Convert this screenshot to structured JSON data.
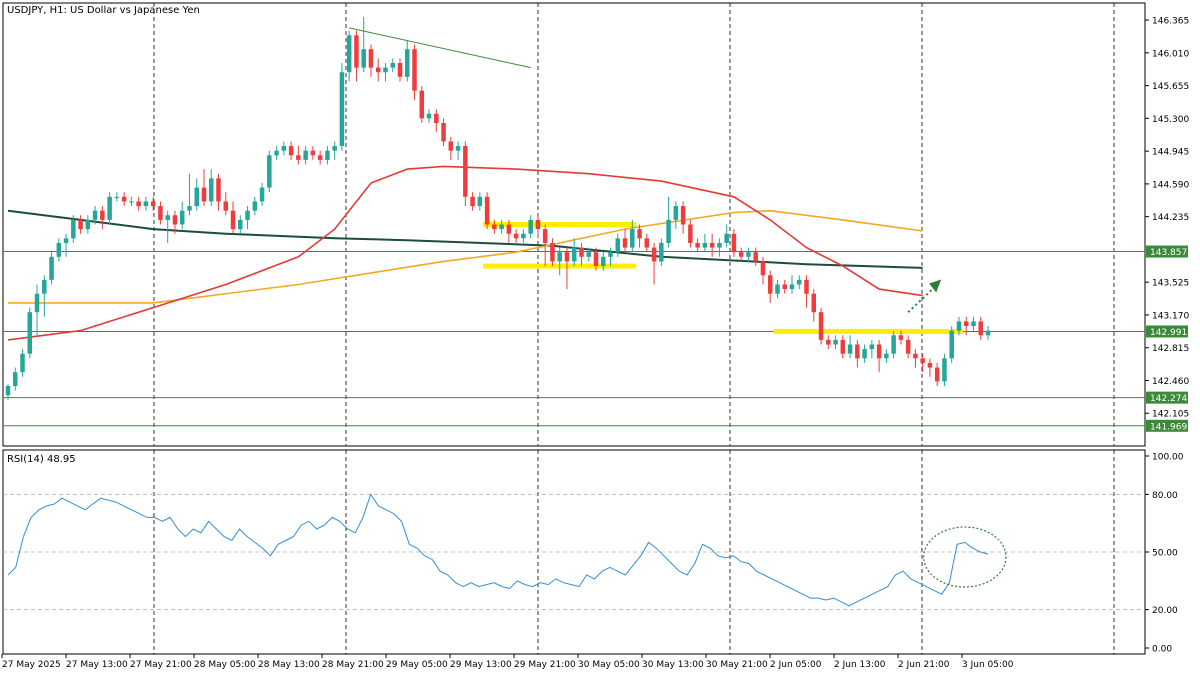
{
  "header": {
    "symbol_label": "USDJPY, H1:  US Dollar vs Japanese Yen",
    "rsi_label": "RSI(14) 48.95"
  },
  "colors": {
    "bull": "#26a69a",
    "bear": "#ef3d3d",
    "ma_fast": "#e53935",
    "ma_mid": "#f5a623",
    "ma_slow": "#1b4d3e",
    "rsi_line": "#2f8fd8",
    "zone": "#ffee00",
    "hline": "#3a8a3a",
    "trend": "#3a8a3a",
    "arrow": "#2e7d32"
  },
  "chart_data": [
    {
      "type": "candlestick",
      "title": "USDJPY, H1:  US Dollar vs Japanese Yen",
      "ylim": [
        141.75,
        146.55
      ],
      "yticks": [
        "146.365",
        "146.010",
        "145.655",
        "145.300",
        "144.945",
        "144.590",
        "144.235",
        "143.525",
        "143.170",
        "142.815",
        "142.460",
        "142.105"
      ],
      "price_lines": [
        {
          "label": "143.857",
          "value": 143.857
        },
        {
          "label": "142.991",
          "value": 142.991
        },
        {
          "label": "142.274",
          "value": 142.274
        },
        {
          "label": "141.969",
          "value": 141.969
        }
      ],
      "xticks": [
        "27 May 2025",
        "27 May 13:00",
        "27 May 21:00",
        "28 May 05:00",
        "28 May 13:00",
        "28 May 21:00",
        "29 May 05:00",
        "29 May 13:00",
        "29 May 21:00",
        "30 May 05:00",
        "30 May 13:00",
        "30 May 21:00",
        "2 Jun 05:00",
        "2 Jun 13:00",
        "2 Jun 21:00",
        "3 Jun 05:00"
      ],
      "candles": [
        [
          142.3,
          142.4,
          142.25,
          142.42
        ],
        [
          142.4,
          142.55,
          142.35,
          142.6
        ],
        [
          142.55,
          142.75,
          142.5,
          142.8
        ],
        [
          142.75,
          143.2,
          142.7,
          143.25
        ],
        [
          143.2,
          143.4,
          142.95,
          143.5
        ],
        [
          143.4,
          143.55,
          143.15,
          143.6
        ],
        [
          143.55,
          143.8,
          143.5,
          143.85
        ],
        [
          143.8,
          143.95,
          143.75,
          144.0
        ],
        [
          143.95,
          144.0,
          143.8,
          144.05
        ],
        [
          144.0,
          144.2,
          143.95,
          144.25
        ],
        [
          144.2,
          144.1,
          144.05,
          144.25
        ],
        [
          144.1,
          144.2,
          144.05,
          144.25
        ],
        [
          144.2,
          144.3,
          144.15,
          144.35
        ],
        [
          144.3,
          144.2,
          144.1,
          144.35
        ],
        [
          144.2,
          144.45,
          144.15,
          144.5
        ],
        [
          144.45,
          144.45,
          144.4,
          144.5
        ],
        [
          144.45,
          144.4,
          144.35,
          144.5
        ],
        [
          144.4,
          144.4,
          144.35,
          144.45
        ],
        [
          144.4,
          144.35,
          144.3,
          144.45
        ],
        [
          144.35,
          144.4,
          144.3,
          144.45
        ],
        [
          144.4,
          144.35,
          144.3,
          144.45
        ],
        [
          144.35,
          144.2,
          144.15,
          144.4
        ],
        [
          144.2,
          144.25,
          143.95,
          144.3
        ],
        [
          144.25,
          144.15,
          144.05,
          144.3
        ],
        [
          144.15,
          144.3,
          144.1,
          144.4
        ],
        [
          144.3,
          144.35,
          144.25,
          144.7
        ],
        [
          144.35,
          144.55,
          144.3,
          144.65
        ],
        [
          144.55,
          144.4,
          144.35,
          144.75
        ],
        [
          144.4,
          144.65,
          144.35,
          144.75
        ],
        [
          144.65,
          144.4,
          144.3,
          144.7
        ],
        [
          144.4,
          144.3,
          144.25,
          144.5
        ],
        [
          144.3,
          144.1,
          144.05,
          144.4
        ],
        [
          144.1,
          144.2,
          144.05,
          144.25
        ],
        [
          144.2,
          144.3,
          144.1,
          144.35
        ],
        [
          144.3,
          144.4,
          144.25,
          144.45
        ],
        [
          144.4,
          144.55,
          144.35,
          144.6
        ],
        [
          144.55,
          144.9,
          144.5,
          144.95
        ],
        [
          144.9,
          144.95,
          144.85,
          145.0
        ],
        [
          144.95,
          145.0,
          144.9,
          145.05
        ],
        [
          145.0,
          144.9,
          144.85,
          145.05
        ],
        [
          144.9,
          144.85,
          144.8,
          145.0
        ],
        [
          144.85,
          144.95,
          144.8,
          145.0
        ],
        [
          144.95,
          144.9,
          144.85,
          145.0
        ],
        [
          144.9,
          144.85,
          144.8,
          144.95
        ],
        [
          144.85,
          144.95,
          144.8,
          145.0
        ],
        [
          144.95,
          145.0,
          144.85,
          145.05
        ],
        [
          145.0,
          145.8,
          144.95,
          145.9
        ],
        [
          145.8,
          146.2,
          145.7,
          146.25
        ],
        [
          146.2,
          145.85,
          145.7,
          146.25
        ],
        [
          145.85,
          146.05,
          145.8,
          146.4
        ],
        [
          146.05,
          145.85,
          145.75,
          146.1
        ],
        [
          145.85,
          145.8,
          145.7,
          145.95
        ],
        [
          145.8,
          145.85,
          145.7,
          145.9
        ],
        [
          145.85,
          145.9,
          145.8,
          145.95
        ],
        [
          145.9,
          145.75,
          145.7,
          145.95
        ],
        [
          145.75,
          146.05,
          145.7,
          146.15
        ],
        [
          146.05,
          145.6,
          145.5,
          146.1
        ],
        [
          145.6,
          145.3,
          145.25,
          145.65
        ],
        [
          145.3,
          145.35,
          145.25,
          145.4
        ],
        [
          145.35,
          145.25,
          145.15,
          145.4
        ],
        [
          145.25,
          145.05,
          145.0,
          145.3
        ],
        [
          145.05,
          144.95,
          144.85,
          145.1
        ],
        [
          144.95,
          145.0,
          144.85,
          145.05
        ],
        [
          145.0,
          144.45,
          144.35,
          145.05
        ],
        [
          144.45,
          144.35,
          144.3,
          144.5
        ],
        [
          144.35,
          144.45,
          144.3,
          144.5
        ],
        [
          144.45,
          144.15,
          144.1,
          144.5
        ],
        [
          144.15,
          144.1,
          144.05,
          144.2
        ],
        [
          144.1,
          144.15,
          144.05,
          144.2
        ],
        [
          144.15,
          144.05,
          143.95,
          144.2
        ],
        [
          144.05,
          144.0,
          143.95,
          144.1
        ],
        [
          144.0,
          144.05,
          143.95,
          144.1
        ],
        [
          144.05,
          144.2,
          144.0,
          144.25
        ],
        [
          144.2,
          144.1,
          144.0,
          144.25
        ],
        [
          144.1,
          143.95,
          143.7,
          144.15
        ],
        [
          143.95,
          143.75,
          143.7,
          144.0
        ],
        [
          143.75,
          143.85,
          143.6,
          143.9
        ],
        [
          143.85,
          143.75,
          143.45,
          143.9
        ],
        [
          143.75,
          143.9,
          143.7,
          144.0
        ],
        [
          143.9,
          143.8,
          143.7,
          143.95
        ],
        [
          143.8,
          143.85,
          143.75,
          143.9
        ],
        [
          143.85,
          143.7,
          143.65,
          143.9
        ],
        [
          143.7,
          143.8,
          143.65,
          143.85
        ],
        [
          143.8,
          143.85,
          143.7,
          143.9
        ],
        [
          143.85,
          144.0,
          143.8,
          144.05
        ],
        [
          144.0,
          143.9,
          143.85,
          144.1
        ],
        [
          143.9,
          144.1,
          143.85,
          144.2
        ],
        [
          144.1,
          144.0,
          143.9,
          144.15
        ],
        [
          144.0,
          143.9,
          143.85,
          144.05
        ],
        [
          143.9,
          143.75,
          143.5,
          143.95
        ],
        [
          143.75,
          143.95,
          143.7,
          144.0
        ],
        [
          143.95,
          144.2,
          143.9,
          144.45
        ],
        [
          144.2,
          144.35,
          144.1,
          144.4
        ],
        [
          144.35,
          144.15,
          144.05,
          144.4
        ],
        [
          144.15,
          143.95,
          143.9,
          144.2
        ],
        [
          143.95,
          143.9,
          143.85,
          144.0
        ],
        [
          143.9,
          143.95,
          143.85,
          144.05
        ],
        [
          143.95,
          143.9,
          143.8,
          144.05
        ],
        [
          143.9,
          143.95,
          143.8,
          144.0
        ],
        [
          143.95,
          144.05,
          143.9,
          144.15
        ],
        [
          144.05,
          143.85,
          143.8,
          144.1
        ],
        [
          143.85,
          143.8,
          143.75,
          143.9
        ],
        [
          143.8,
          143.85,
          143.75,
          143.9
        ],
        [
          143.85,
          143.75,
          143.7,
          143.9
        ],
        [
          143.75,
          143.6,
          143.5,
          143.8
        ],
        [
          143.6,
          143.4,
          143.3,
          143.65
        ],
        [
          143.4,
          143.5,
          143.35,
          143.55
        ],
        [
          143.5,
          143.45,
          143.4,
          143.55
        ],
        [
          143.45,
          143.5,
          143.4,
          143.6
        ],
        [
          143.5,
          143.55,
          143.45,
          143.6
        ],
        [
          143.55,
          143.4,
          143.25,
          143.6
        ],
        [
          143.4,
          143.2,
          143.1,
          143.45
        ],
        [
          143.2,
          142.9,
          142.85,
          143.25
        ],
        [
          142.9,
          142.85,
          142.8,
          142.95
        ],
        [
          142.85,
          142.9,
          142.8,
          142.95
        ],
        [
          142.9,
          142.75,
          142.7,
          142.95
        ],
        [
          142.75,
          142.85,
          142.7,
          142.95
        ],
        [
          142.85,
          142.7,
          142.6,
          142.9
        ],
        [
          142.7,
          142.8,
          142.65,
          142.85
        ],
        [
          142.8,
          142.85,
          142.7,
          142.9
        ],
        [
          142.85,
          142.7,
          142.55,
          142.9
        ],
        [
          142.7,
          142.75,
          142.65,
          142.8
        ],
        [
          142.75,
          142.95,
          142.7,
          143.0
        ],
        [
          142.95,
          142.9,
          142.85,
          143.0
        ],
        [
          142.9,
          142.75,
          142.7,
          142.95
        ],
        [
          142.75,
          142.7,
          142.6,
          142.8
        ],
        [
          142.7,
          142.65,
          142.55,
          142.75
        ],
        [
          142.65,
          142.6,
          142.5,
          142.7
        ],
        [
          142.6,
          142.45,
          142.4,
          142.65
        ],
        [
          142.45,
          142.7,
          142.4,
          142.75
        ],
        [
          142.7,
          143.0,
          142.65,
          143.05
        ],
        [
          143.0,
          143.1,
          142.95,
          143.15
        ],
        [
          143.1,
          143.05,
          142.95,
          143.15
        ],
        [
          143.05,
          143.1,
          143.0,
          143.15
        ],
        [
          143.1,
          142.95,
          142.9,
          143.15
        ],
        [
          142.95,
          143.0,
          142.9,
          143.05
        ]
      ],
      "ma_fast": [
        [
          0,
          142.9
        ],
        [
          10,
          143.0
        ],
        [
          20,
          143.25
        ],
        [
          30,
          143.5
        ],
        [
          40,
          143.8
        ],
        [
          45,
          144.1
        ],
        [
          50,
          144.6
        ],
        [
          55,
          144.75
        ],
        [
          60,
          144.78
        ],
        [
          70,
          144.75
        ],
        [
          80,
          144.7
        ],
        [
          90,
          144.62
        ],
        [
          100,
          144.45
        ],
        [
          105,
          144.2
        ],
        [
          110,
          143.9
        ],
        [
          115,
          143.7
        ],
        [
          120,
          143.45
        ],
        [
          126,
          143.38
        ]
      ],
      "ma_mid": [
        [
          0,
          143.3
        ],
        [
          20,
          143.3
        ],
        [
          40,
          143.5
        ],
        [
          60,
          143.75
        ],
        [
          70,
          143.85
        ],
        [
          85,
          144.1
        ],
        [
          100,
          144.28
        ],
        [
          105,
          144.3
        ],
        [
          115,
          144.2
        ],
        [
          126,
          144.08
        ]
      ],
      "ma_slow": [
        [
          0,
          144.3
        ],
        [
          10,
          144.2
        ],
        [
          20,
          144.1
        ],
        [
          30,
          144.05
        ],
        [
          45,
          144.0
        ],
        [
          55,
          143.98
        ],
        [
          75,
          143.92
        ],
        [
          90,
          143.8
        ],
        [
          110,
          143.72
        ],
        [
          126,
          143.68
        ]
      ],
      "zones": [
        {
          "i0": 66,
          "i1": 86,
          "value": 144.15
        },
        {
          "i0": 66,
          "i1": 86,
          "value": 143.7
        },
        {
          "i0": 106,
          "i1": 131,
          "value": 142.991
        }
      ],
      "trendline": [
        [
          47,
          146.28
        ],
        [
          72,
          145.85
        ]
      ],
      "arrow": [
        [
          124,
          143.2
        ],
        [
          128,
          143.5
        ]
      ]
    },
    {
      "type": "line",
      "title": "RSI(14) 48.95",
      "ylim": [
        0,
        100
      ],
      "yticks": [
        "100.00",
        "80.00",
        "50.00",
        "20.00",
        "0.00"
      ],
      "levels": [
        80,
        50,
        20
      ],
      "values": [
        38,
        42,
        58,
        68,
        72,
        74,
        75,
        78,
        76,
        74,
        72,
        75,
        78,
        77,
        76,
        74,
        72,
        70,
        68,
        68,
        66,
        68,
        62,
        58,
        62,
        60,
        66,
        62,
        58,
        56,
        62,
        58,
        55,
        52,
        48,
        54,
        56,
        58,
        64,
        66,
        62,
        64,
        68,
        66,
        62,
        60,
        68,
        80,
        74,
        72,
        70,
        66,
        54,
        52,
        48,
        46,
        40,
        38,
        34,
        32,
        34,
        32,
        33,
        34,
        32,
        31,
        35,
        33,
        32,
        34,
        33,
        36,
        34,
        33,
        32,
        38,
        36,
        40,
        42,
        40,
        38,
        43,
        48,
        55,
        52,
        48,
        44,
        40,
        38,
        44,
        54,
        52,
        48,
        47,
        48,
        45,
        44,
        40,
        38,
        36,
        34,
        32,
        30,
        28,
        26,
        26,
        25,
        26,
        24,
        22,
        24,
        26,
        28,
        30,
        32,
        38,
        40,
        36,
        34,
        32,
        30,
        28,
        34,
        54,
        55,
        52,
        50,
        48.95
      ],
      "annotation_circle": [
        121,
        127,
        50
      ]
    }
  ]
}
